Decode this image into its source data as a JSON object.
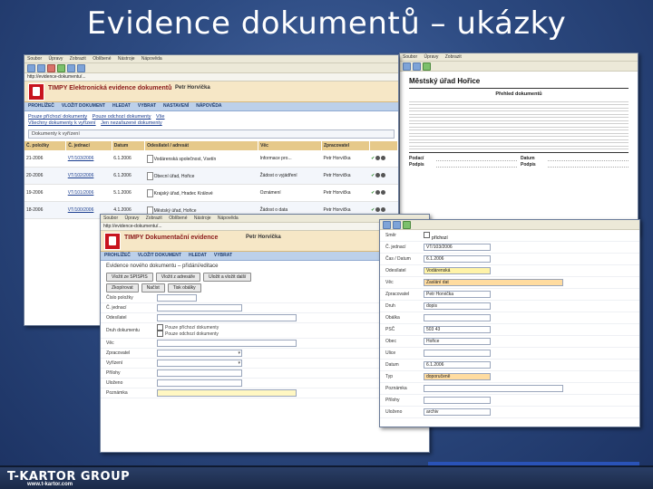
{
  "slide": {
    "title": "Evidence dokumentů – ukázky",
    "footer_logo": "T-KARTOR GROUP",
    "footer_url": "www.t-kartor.com"
  },
  "browser": {
    "menu": [
      "Soubor",
      "Úpravy",
      "Zobrazit",
      "Oblíbené",
      "Nástroje",
      "Nápověda"
    ],
    "address": "http://evidence-dokumentu/..."
  },
  "app": {
    "brand": "TIMPY  Elektronická evidence dokumentů",
    "user": "Petr Horvička",
    "nav": [
      "PROHLÍŽEČ",
      "VLOŽIT DOKUMENT",
      "HLEDAT",
      "VYBRAT",
      "NASTAVENÍ",
      "NÁPOVĚDA"
    ]
  },
  "list_window": {
    "links": [
      "Pouze příchozí dokumenty",
      "Pouze odchozí dokumenty",
      "Vše",
      "Všechny dokumenty k vyřízení",
      "Jen nezařazené dokumenty"
    ],
    "filter_label": "Dokumenty k vyřízení",
    "columns": [
      "Č. položky",
      "Č. jednací",
      "Datum",
      "Odesílatel / adresát",
      "Věc",
      "Zpracovatel"
    ],
    "rows": [
      {
        "no": "21-2006",
        "cj": "VT/103/2006",
        "date": "6.1.2006",
        "sender": "Vodárenská společnost, Vsetín",
        "subject": "Informace pro...",
        "user": "Petr Horvička"
      },
      {
        "no": "20-2006",
        "cj": "VT/102/2006",
        "date": "6.1.2006",
        "sender": "Obecní úřad, Hořice",
        "subject": "Žádost o vyjádření",
        "user": "Petr Horvička"
      },
      {
        "no": "19-2006",
        "cj": "VT/101/2006",
        "date": "5.1.2006",
        "sender": "Krajský úřad, Hradec Králové",
        "subject": "Oznámení",
        "user": "Petr Horvička"
      },
      {
        "no": "18-2006",
        "cj": "VT/100/2006",
        "date": "4.1.2006",
        "sender": "Městský úřad, Hořice",
        "subject": "Žádost o data",
        "user": "Petr Horvička"
      }
    ]
  },
  "doc_window": {
    "heading": "Městský úřad Hořice",
    "subheading": "Přehled dokumentů",
    "fields": [
      "Podací",
      "Datum",
      "Podpis"
    ]
  },
  "form_window": {
    "brand": "TIMPY  Dokumentační evidence",
    "user": "Petr Horvička",
    "title": "Evidence nového dokumentu – přidání/editace",
    "buttons": [
      "Vložit ze SPISPIS",
      "Vložit z adresáře",
      "Uložit a vložit další",
      "Zkopírovat",
      "Načíst",
      "Tisk obálky"
    ],
    "fields": [
      "Číslo položky",
      "Č. jednací",
      "Odesílatel",
      "Druh dokumentu",
      "Věc",
      "Zpracovatel",
      "Vyřízení",
      "Přílohy",
      "Uloženo",
      "Poznámka"
    ],
    "radio": [
      "Pouze příchozí dokumenty",
      "Pouze odchozí dokumenty"
    ]
  },
  "detail_window": {
    "fields": [
      {
        "label": "Směr",
        "value": "příchozí"
      },
      {
        "label": "Č. jednací",
        "value": "VT/103/2006"
      },
      {
        "label": "Čas / Datum",
        "value": "6.1.2006"
      },
      {
        "label": "Odesílatel",
        "value": "Vodárenská"
      },
      {
        "label": "Věc",
        "value": "Zaslání dat"
      },
      {
        "label": "Zpracovatel",
        "value": "Petr Horvička"
      },
      {
        "label": "Druh",
        "value": "dopis"
      },
      {
        "label": "Obálka",
        "value": ""
      },
      {
        "label": "PSČ",
        "value": "503 43"
      },
      {
        "label": "Obec",
        "value": "Hořice"
      },
      {
        "label": "Ulice",
        "value": ""
      },
      {
        "label": "Datum",
        "value": "6.1.2006"
      },
      {
        "label": "Typ",
        "value": "doporučeně"
      },
      {
        "label": "Poznámka",
        "value": ""
      },
      {
        "label": "Přílohy",
        "value": ""
      },
      {
        "label": "Uloženo",
        "value": "archiv"
      }
    ]
  }
}
